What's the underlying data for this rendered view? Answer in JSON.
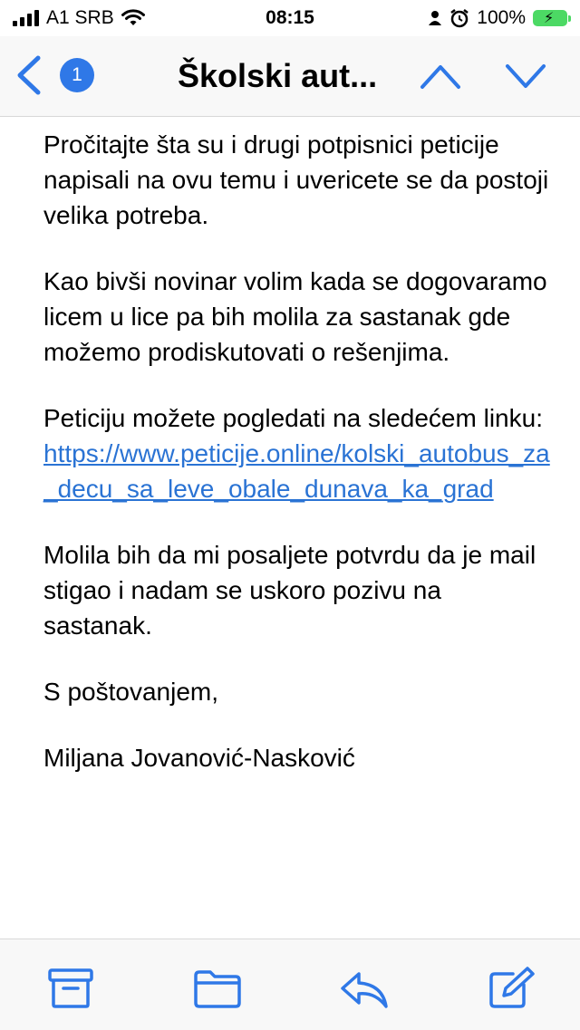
{
  "status_bar": {
    "carrier": "A1 SRB",
    "time": "08:15",
    "battery": "100%"
  },
  "nav": {
    "unread_count": "1",
    "title": "Školski aut..."
  },
  "email": {
    "paragraphs": [
      "Pročitajte šta su i drugi potpisnici peticije napisali na ovu temu i uvericete se da postoji velika potreba.",
      "Kao bivši novinar volim kada se dogovaramo licem u lice pa bih molila za sastanak gde možemo prodiskutovati o rešenjima."
    ],
    "link_intro": "Peticiju možete pogledati na sledećem linku: ",
    "link_text": "https://www.peticije.online/kolski_autobus_za_decu_sa_leve_obale_dunava_ka_grad",
    "closing_paragraph": "Molila bih da mi posaljete potvrdu da je mail stigao i nadam se uskoro pozivu na sastanak.",
    "greeting": "S poštovanjem,",
    "signature": "Miljana Jovanović-Nasković"
  },
  "icons": {
    "back": "chevron-left-icon",
    "up": "chevron-up-icon",
    "down": "chevron-down-icon",
    "archive": "archive-icon",
    "folder": "folder-icon",
    "reply": "reply-icon",
    "compose": "compose-icon"
  },
  "colors": {
    "accent": "#2f78e7",
    "link": "#2a73d4",
    "battery": "#4cd964"
  }
}
